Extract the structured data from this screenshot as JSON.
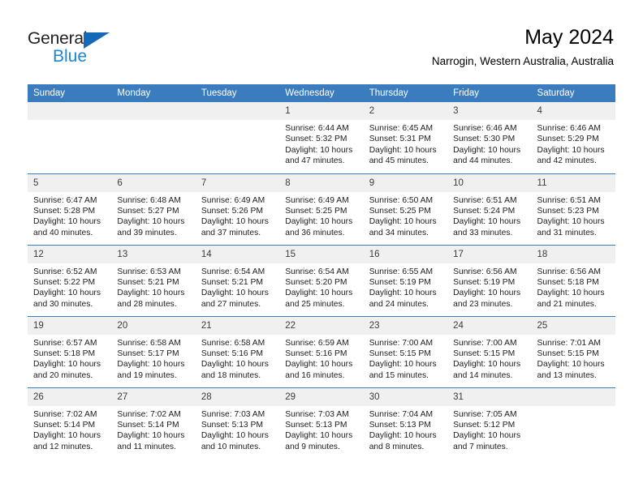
{
  "brand": {
    "name_dark": "General",
    "name_light": "Blue",
    "accent_blue": "#1a86d8",
    "triangle_blue": "#1567b8"
  },
  "header": {
    "title": "May 2024",
    "subtitle": "Narrogin, Western Australia, Australia"
  },
  "theme": {
    "header_row_bg": "#3a7cbe",
    "daynum_bg": "#f0f0f0",
    "row_divider": "#3a7cbe"
  },
  "weekday_headers": [
    "Sunday",
    "Monday",
    "Tuesday",
    "Wednesday",
    "Thursday",
    "Friday",
    "Saturday"
  ],
  "weeks": [
    [
      {
        "empty": true,
        "day": "",
        "sunrise": "",
        "sunset": "",
        "daylight_line1": "",
        "daylight_line2": ""
      },
      {
        "empty": true,
        "day": "",
        "sunrise": "",
        "sunset": "",
        "daylight_line1": "",
        "daylight_line2": ""
      },
      {
        "empty": true,
        "day": "",
        "sunrise": "",
        "sunset": "",
        "daylight_line1": "",
        "daylight_line2": ""
      },
      {
        "empty": false,
        "day": "1",
        "sunrise": "Sunrise: 6:44 AM",
        "sunset": "Sunset: 5:32 PM",
        "daylight_line1": "Daylight: 10 hours",
        "daylight_line2": "and 47 minutes."
      },
      {
        "empty": false,
        "day": "2",
        "sunrise": "Sunrise: 6:45 AM",
        "sunset": "Sunset: 5:31 PM",
        "daylight_line1": "Daylight: 10 hours",
        "daylight_line2": "and 45 minutes."
      },
      {
        "empty": false,
        "day": "3",
        "sunrise": "Sunrise: 6:46 AM",
        "sunset": "Sunset: 5:30 PM",
        "daylight_line1": "Daylight: 10 hours",
        "daylight_line2": "and 44 minutes."
      },
      {
        "empty": false,
        "day": "4",
        "sunrise": "Sunrise: 6:46 AM",
        "sunset": "Sunset: 5:29 PM",
        "daylight_line1": "Daylight: 10 hours",
        "daylight_line2": "and 42 minutes."
      }
    ],
    [
      {
        "empty": false,
        "day": "5",
        "sunrise": "Sunrise: 6:47 AM",
        "sunset": "Sunset: 5:28 PM",
        "daylight_line1": "Daylight: 10 hours",
        "daylight_line2": "and 40 minutes."
      },
      {
        "empty": false,
        "day": "6",
        "sunrise": "Sunrise: 6:48 AM",
        "sunset": "Sunset: 5:27 PM",
        "daylight_line1": "Daylight: 10 hours",
        "daylight_line2": "and 39 minutes."
      },
      {
        "empty": false,
        "day": "7",
        "sunrise": "Sunrise: 6:49 AM",
        "sunset": "Sunset: 5:26 PM",
        "daylight_line1": "Daylight: 10 hours",
        "daylight_line2": "and 37 minutes."
      },
      {
        "empty": false,
        "day": "8",
        "sunrise": "Sunrise: 6:49 AM",
        "sunset": "Sunset: 5:25 PM",
        "daylight_line1": "Daylight: 10 hours",
        "daylight_line2": "and 36 minutes."
      },
      {
        "empty": false,
        "day": "9",
        "sunrise": "Sunrise: 6:50 AM",
        "sunset": "Sunset: 5:25 PM",
        "daylight_line1": "Daylight: 10 hours",
        "daylight_line2": "and 34 minutes."
      },
      {
        "empty": false,
        "day": "10",
        "sunrise": "Sunrise: 6:51 AM",
        "sunset": "Sunset: 5:24 PM",
        "daylight_line1": "Daylight: 10 hours",
        "daylight_line2": "and 33 minutes."
      },
      {
        "empty": false,
        "day": "11",
        "sunrise": "Sunrise: 6:51 AM",
        "sunset": "Sunset: 5:23 PM",
        "daylight_line1": "Daylight: 10 hours",
        "daylight_line2": "and 31 minutes."
      }
    ],
    [
      {
        "empty": false,
        "day": "12",
        "sunrise": "Sunrise: 6:52 AM",
        "sunset": "Sunset: 5:22 PM",
        "daylight_line1": "Daylight: 10 hours",
        "daylight_line2": "and 30 minutes."
      },
      {
        "empty": false,
        "day": "13",
        "sunrise": "Sunrise: 6:53 AM",
        "sunset": "Sunset: 5:21 PM",
        "daylight_line1": "Daylight: 10 hours",
        "daylight_line2": "and 28 minutes."
      },
      {
        "empty": false,
        "day": "14",
        "sunrise": "Sunrise: 6:54 AM",
        "sunset": "Sunset: 5:21 PM",
        "daylight_line1": "Daylight: 10 hours",
        "daylight_line2": "and 27 minutes."
      },
      {
        "empty": false,
        "day": "15",
        "sunrise": "Sunrise: 6:54 AM",
        "sunset": "Sunset: 5:20 PM",
        "daylight_line1": "Daylight: 10 hours",
        "daylight_line2": "and 25 minutes."
      },
      {
        "empty": false,
        "day": "16",
        "sunrise": "Sunrise: 6:55 AM",
        "sunset": "Sunset: 5:19 PM",
        "daylight_line1": "Daylight: 10 hours",
        "daylight_line2": "and 24 minutes."
      },
      {
        "empty": false,
        "day": "17",
        "sunrise": "Sunrise: 6:56 AM",
        "sunset": "Sunset: 5:19 PM",
        "daylight_line1": "Daylight: 10 hours",
        "daylight_line2": "and 23 minutes."
      },
      {
        "empty": false,
        "day": "18",
        "sunrise": "Sunrise: 6:56 AM",
        "sunset": "Sunset: 5:18 PM",
        "daylight_line1": "Daylight: 10 hours",
        "daylight_line2": "and 21 minutes."
      }
    ],
    [
      {
        "empty": false,
        "day": "19",
        "sunrise": "Sunrise: 6:57 AM",
        "sunset": "Sunset: 5:18 PM",
        "daylight_line1": "Daylight: 10 hours",
        "daylight_line2": "and 20 minutes."
      },
      {
        "empty": false,
        "day": "20",
        "sunrise": "Sunrise: 6:58 AM",
        "sunset": "Sunset: 5:17 PM",
        "daylight_line1": "Daylight: 10 hours",
        "daylight_line2": "and 19 minutes."
      },
      {
        "empty": false,
        "day": "21",
        "sunrise": "Sunrise: 6:58 AM",
        "sunset": "Sunset: 5:16 PM",
        "daylight_line1": "Daylight: 10 hours",
        "daylight_line2": "and 18 minutes."
      },
      {
        "empty": false,
        "day": "22",
        "sunrise": "Sunrise: 6:59 AM",
        "sunset": "Sunset: 5:16 PM",
        "daylight_line1": "Daylight: 10 hours",
        "daylight_line2": "and 16 minutes."
      },
      {
        "empty": false,
        "day": "23",
        "sunrise": "Sunrise: 7:00 AM",
        "sunset": "Sunset: 5:15 PM",
        "daylight_line1": "Daylight: 10 hours",
        "daylight_line2": "and 15 minutes."
      },
      {
        "empty": false,
        "day": "24",
        "sunrise": "Sunrise: 7:00 AM",
        "sunset": "Sunset: 5:15 PM",
        "daylight_line1": "Daylight: 10 hours",
        "daylight_line2": "and 14 minutes."
      },
      {
        "empty": false,
        "day": "25",
        "sunrise": "Sunrise: 7:01 AM",
        "sunset": "Sunset: 5:15 PM",
        "daylight_line1": "Daylight: 10 hours",
        "daylight_line2": "and 13 minutes."
      }
    ],
    [
      {
        "empty": false,
        "day": "26",
        "sunrise": "Sunrise: 7:02 AM",
        "sunset": "Sunset: 5:14 PM",
        "daylight_line1": "Daylight: 10 hours",
        "daylight_line2": "and 12 minutes."
      },
      {
        "empty": false,
        "day": "27",
        "sunrise": "Sunrise: 7:02 AM",
        "sunset": "Sunset: 5:14 PM",
        "daylight_line1": "Daylight: 10 hours",
        "daylight_line2": "and 11 minutes."
      },
      {
        "empty": false,
        "day": "28",
        "sunrise": "Sunrise: 7:03 AM",
        "sunset": "Sunset: 5:13 PM",
        "daylight_line1": "Daylight: 10 hours",
        "daylight_line2": "and 10 minutes."
      },
      {
        "empty": false,
        "day": "29",
        "sunrise": "Sunrise: 7:03 AM",
        "sunset": "Sunset: 5:13 PM",
        "daylight_line1": "Daylight: 10 hours",
        "daylight_line2": "and 9 minutes."
      },
      {
        "empty": false,
        "day": "30",
        "sunrise": "Sunrise: 7:04 AM",
        "sunset": "Sunset: 5:13 PM",
        "daylight_line1": "Daylight: 10 hours",
        "daylight_line2": "and 8 minutes."
      },
      {
        "empty": false,
        "day": "31",
        "sunrise": "Sunrise: 7:05 AM",
        "sunset": "Sunset: 5:12 PM",
        "daylight_line1": "Daylight: 10 hours",
        "daylight_line2": "and 7 minutes."
      },
      {
        "empty": true,
        "day": "",
        "sunrise": "",
        "sunset": "",
        "daylight_line1": "",
        "daylight_line2": ""
      }
    ]
  ]
}
